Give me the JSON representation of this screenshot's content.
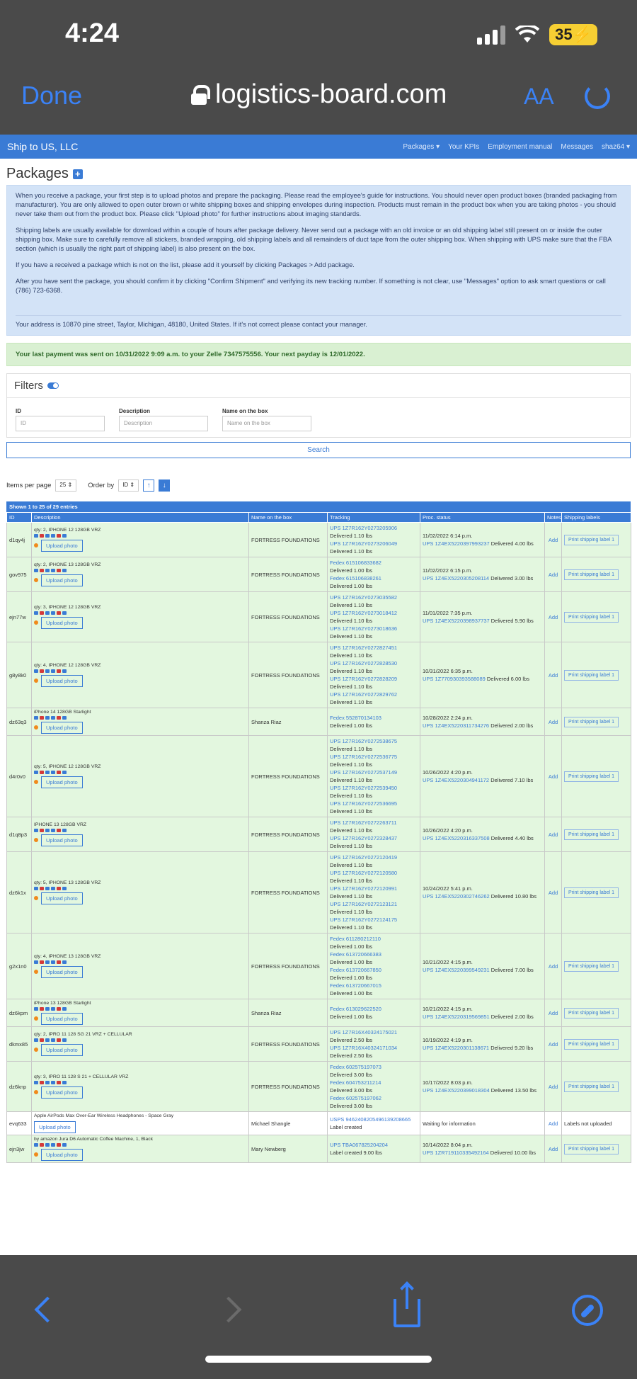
{
  "status": {
    "time": "4:24",
    "battery": "35"
  },
  "safari": {
    "done": "Done",
    "url": "logistics-board.com",
    "aa": "AA"
  },
  "navbar": {
    "brand": "Ship to US, LLC",
    "links": [
      "Packages ▾",
      "Your KPIs",
      "Employment manual",
      "Messages",
      "shaz64 ▾"
    ]
  },
  "page_title": "Packages",
  "info": {
    "p1": "When you receive a package, your first step is to upload photos and prepare the packaging. Please read the employee's guide for instructions. You should never open product boxes (branded packaging from manufacturer). You are only allowed to open outer brown or white shipping boxes and shipping envelopes during inspection. Products must remain in the product box when you are taking photos - you should never take them out from the product box. Please click \"Upload photo\" for further instructions about imaging standards.",
    "p2": "Shipping labels are usually available for download within a couple of hours after package delivery. Never send out a package with an old invoice or an old shipping label still present on or inside the outer shipping box. Make sure to carefully remove all stickers, branded wrapping, old shipping labels and all remainders of duct tape from the outer shipping box. When shipping with UPS make sure that the FBA section (which is usually the right part of shipping label) is also present on the box.",
    "p3": "If you have a received a package which is not on the list, please add it yourself by clicking Packages > Add package.",
    "p4": "After you have sent the package, you should confirm it by clicking \"Confirm Shipment\" and verifying its new tracking number. If something is not clear, use \"Messages\" option to ask smart questions or call (786) 723-6368.",
    "address": "Your address is 10870 pine street, Taylor, Michigan, 48180, United States. If it's not correct please contact your manager."
  },
  "payment": "Your last payment was sent on 10/31/2022 9:09 a.m. to your Zelle 7347575556. Your next payday is 12/01/2022.",
  "filters": {
    "title": "Filters",
    "id_label": "ID",
    "id_placeholder": "ID",
    "desc_label": "Description",
    "desc_placeholder": "Description",
    "name_label": "Name on the box",
    "name_placeholder": "Name on the box",
    "search": "Search"
  },
  "controls": {
    "items_label": "Items per page",
    "items_value": "25",
    "order_label": "Order by",
    "order_value": "ID",
    "up": "↑",
    "down": "↓"
  },
  "table": {
    "shown": "Shown 1 to 25 of 29 entries",
    "headers": [
      "ID",
      "Description",
      "Name on the box",
      "Tracking",
      "Proc. status",
      "Notes",
      "Shipping labels"
    ],
    "upload": "Upload photo",
    "add": "Add",
    "print": "Print shipping label 1",
    "rows": [
      {
        "id": "d1qy4j",
        "desc": "qty: 2, IPHONE 12 128GB VRZ",
        "name": "FORTRESS FOUNDATIONS",
        "tracking": [
          [
            "UPS 1Z7R162Y0273205906",
            "Delivered 1.10 lbs"
          ],
          [
            "UPS 1Z7R162Y0273206049",
            "Delivered 1.10 lbs"
          ]
        ],
        "date": "11/02/2022 6:14 p.m.",
        "ptrack": "UPS 1Z4EX5220397993237",
        "pdel": "Delivered 4.00 lbs"
      },
      {
        "id": "gov975",
        "desc": "qty: 2, IPHONE 13 128GB VRZ",
        "name": "FORTRESS FOUNDATIONS",
        "tracking": [
          [
            "Fedex 615106833682",
            "Delivered 1.00 lbs"
          ],
          [
            "Fedex 615106838261",
            "Delivered 1.00 lbs"
          ]
        ],
        "date": "11/02/2022 6:15 p.m.",
        "ptrack": "UPS 1Z4EX5220305208114",
        "pdel": "Delivered 3.00 lbs"
      },
      {
        "id": "ejn77w",
        "desc": "qty: 3, IPHONE 12 128GB VRZ",
        "name": "FORTRESS FOUNDATIONS",
        "tracking": [
          [
            "UPS 1Z7R162Y0273035582",
            "Delivered 1.10 lbs"
          ],
          [
            "UPS 1Z7R162Y0273018412",
            "Delivered 1.10 lbs"
          ],
          [
            "UPS 1Z7R162Y0273018636",
            "Delivered 1.10 lbs"
          ]
        ],
        "date": "11/01/2022 7:35 p.m.",
        "ptrack": "UPS 1Z4EX5220398937737",
        "pdel": "Delivered 5.90 lbs"
      },
      {
        "id": "g8y8k0",
        "desc": "qty: 4, IPHONE 12 128GB VRZ",
        "name": "FORTRESS FOUNDATIONS",
        "tracking": [
          [
            "UPS 1Z7R162Y0272827451",
            "Delivered 1.10 lbs"
          ],
          [
            "UPS 1Z7R162Y0272828530",
            "Delivered 1.10 lbs"
          ],
          [
            "UPS 1Z7R162Y0272828209",
            "Delivered 1.10 lbs"
          ],
          [
            "UPS 1Z7R162Y0272829762",
            "Delivered 1.10 lbs"
          ]
        ],
        "date": "10/31/2022 6:35 p.m.",
        "ptrack": "UPS 1Z7709303935880​89",
        "pdel": "Delivered 6.00 lbs"
      },
      {
        "id": "dz63q3",
        "desc": "iPhone 14 128GB Starlight",
        "name": "Shanza Riaz",
        "tracking": [
          [
            "Fedex 552870134103",
            "Delivered 1.00 lbs"
          ]
        ],
        "date": "10/28/2022 2:24 p.m.",
        "ptrack": "UPS 1Z4EX5220311734276",
        "pdel": "Delivered 2.00 lbs"
      },
      {
        "id": "d4r0v0",
        "desc": "qty: 5, IPHONE 12 128GB VRZ",
        "name": "FORTRESS FOUNDATIONS",
        "tracking": [
          [
            "UPS 1Z7R162Y0272538675",
            "Delivered 1.10 lbs"
          ],
          [
            "UPS 1Z7R162Y0272536775",
            "Delivered 1.10 lbs"
          ],
          [
            "UPS 1Z7R162Y0272537149",
            "Delivered 1.10 lbs"
          ],
          [
            "UPS 1Z7R162Y0272539450",
            "Delivered 1.10 lbs"
          ],
          [
            "UPS 1Z7R162Y0272536695",
            "Delivered 1.10 lbs"
          ]
        ],
        "date": "10/26/2022 4:20 p.m.",
        "ptrack": "UPS 1Z4EX5220304941172",
        "pdel": "Delivered 7.10 lbs"
      },
      {
        "id": "d1q8p3",
        "desc": "IPHONE 13 128GB VRZ",
        "name": "FORTRESS FOUNDATIONS",
        "tracking": [
          [
            "UPS 1Z7R162Y0272263711",
            "Delivered 1.10 lbs"
          ],
          [
            "UPS 1Z7R162Y0272328437",
            "Delivered 1.10 lbs"
          ]
        ],
        "date": "10/26/2022 4:20 p.m.",
        "ptrack": "UPS 1Z4EX5220316337508",
        "pdel": "Delivered 4.40 lbs"
      },
      {
        "id": "dz6k1x",
        "desc": "qty: 5, IPHONE 13 128GB VRZ",
        "name": "FORTRESS FOUNDATIONS",
        "tracking": [
          [
            "UPS 1Z7R162Y0272120419",
            "Delivered 1.10 lbs"
          ],
          [
            "UPS 1Z7R162Y0272120580",
            "Delivered 1.10 lbs"
          ],
          [
            "UPS 1Z7R162Y0272120991",
            "Delivered 1.10 lbs"
          ],
          [
            "UPS 1Z7R162Y0272123121",
            "Delivered 1.10 lbs"
          ],
          [
            "UPS 1Z7R162Y0272124175",
            "Delivered 1.10 lbs"
          ]
        ],
        "date": "10/24/2022 5:41 p.m.",
        "ptrack": "UPS 1Z4EX5220302746262",
        "pdel": "Delivered 10.80 lbs"
      },
      {
        "id": "g2x1n0",
        "desc": "qty: 4, IPHONE 13 128GB VRZ",
        "name": "FORTRESS FOUNDATIONS",
        "tracking": [
          [
            "Fedex 611280212110",
            "Delivered 1.00 lbs"
          ],
          [
            "Fedex 613720666383",
            "Delivered 1.00 lbs"
          ],
          [
            "Fedex 613720667850",
            "Delivered 1.00 lbs"
          ],
          [
            "Fedex 613720667015",
            "Delivered 1.00 lbs"
          ]
        ],
        "date": "10/21/2022 4:15 p.m.",
        "ptrack": "UPS 1Z4EX5220399549231",
        "pdel": "Delivered 7.00 lbs"
      },
      {
        "id": "dz6kpm",
        "desc": "iPhone 13 128GB Starlight",
        "name": "Shanza Riaz",
        "tracking": [
          [
            "Fedex 613029622520",
            "Delivered 1.00 lbs"
          ]
        ],
        "date": "10/21/2022 4:15 p.m.",
        "ptrack": "UPS 1Z4EX5220319569851",
        "pdel": "Delivered 2.00 lbs"
      },
      {
        "id": "dkmx85",
        "desc": "qty: 2, IPRO 11 128 SG 21 VRZ + CELLULAR",
        "name": "FORTRESS FOUNDATIONS",
        "tracking": [
          [
            "UPS 1Z7R16X40324175021",
            "Delivered 2.50 lbs"
          ],
          [
            "UPS 1Z7R16X40324171034",
            "Delivered 2.50 lbs"
          ]
        ],
        "date": "10/19/2022 4:19 p.m.",
        "ptrack": "UPS 1Z4EX5220301138671",
        "pdel": "Delivered 9.20 lbs"
      },
      {
        "id": "dz6knp",
        "desc": "qty: 3, IPRO 11 128 S 21 + CELLULAR VRZ",
        "name": "FORTRESS FOUNDATIONS",
        "tracking": [
          [
            "Fedex 602575197073",
            "Delivered 3.00 lbs"
          ],
          [
            "Fedex 604753211214",
            "Delivered 3.00 lbs"
          ],
          [
            "Fedex 602575197062",
            "Delivered 3.00 lbs"
          ]
        ],
        "date": "10/17/2022 8:03 p.m.",
        "ptrack": "UPS 1Z4EX5220399018304",
        "pdel": "Delivered 13.50 lbs"
      },
      {
        "id": "evq633",
        "desc": "Apple AirPods Max Over-Ear Wireless Headphones - Space Gray",
        "name": "Michael Shangle",
        "tracking": [
          [
            "USPS 9462408205496139208665",
            "Label created"
          ]
        ],
        "status_text": "Waiting for information",
        "label_text": "Labels not uploaded",
        "white": true
      },
      {
        "id": "ejn3jw",
        "desc": "by amazon Jura D6 Automatic Coffee Machine, 1, Black",
        "name": "Mary Newberg",
        "tracking": [
          [
            "UPS TBA067825204204",
            "Label created 9.00 lbs"
          ]
        ],
        "date": "10/14/2022 8:04 p.m.",
        "ptrack": "UPS 1ZR719110335492164",
        "pdel": "Delivered 10.00 lbs"
      }
    ]
  }
}
